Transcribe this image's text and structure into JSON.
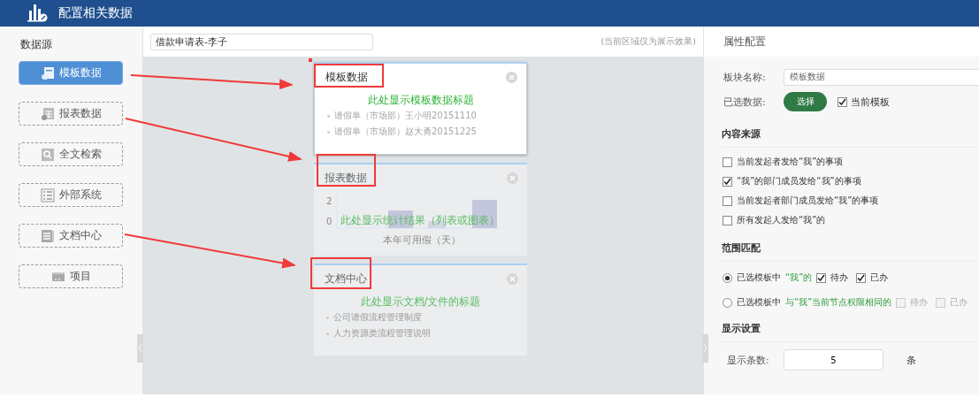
{
  "header": {
    "title": "配置相关数据"
  },
  "sidebar": {
    "title": "数据源",
    "items": [
      {
        "label": "模板数据",
        "selected": true
      },
      {
        "label": "报表数据",
        "selected": false
      },
      {
        "label": "全文检索",
        "selected": false
      },
      {
        "label": "外部系统",
        "selected": false
      },
      {
        "label": "文档中心",
        "selected": false
      },
      {
        "label": "项目",
        "selected": false
      }
    ]
  },
  "preview": {
    "form_field": {
      "value": "借款申请表-李子"
    },
    "note": "(当前区域仅为展示效果)",
    "cards": [
      {
        "kind": "list",
        "title": "模板数据",
        "selected": true,
        "hint": "此处显示模板数据标题",
        "items": [
          "请假单（市场部）王小明20151110",
          "请假单（市场部）赵大勇20151225"
        ]
      },
      {
        "kind": "chart",
        "title": "报表数据",
        "selected": false,
        "hint": "此处显示统计结果（列表或图表）",
        "y_ticks": [
          "2",
          "0"
        ],
        "caption": "本年可用假（天）"
      },
      {
        "kind": "list",
        "title": "文档中心",
        "selected": false,
        "hint": "此处显示文档/文件的标题",
        "items": [
          "公司请假流程管理制度",
          "人力资源类流程管理说明"
        ]
      }
    ]
  },
  "properties": {
    "title": "属性配置",
    "block_name": {
      "label": "板块名称:",
      "value": "模板数据"
    },
    "selected_data": {
      "label": "已选数据:",
      "button": "选择",
      "checkbox": {
        "label": "当前模板",
        "checked": true
      }
    },
    "content_source": {
      "title": "内容来源",
      "options": [
        {
          "label": "当前发起者发给“我”的事项",
          "checked": false
        },
        {
          "label": "“我”的部门成员发给“我”的事项",
          "checked": true
        },
        {
          "label": "当前发起者部门成员发给“我”的事项",
          "checked": false
        },
        {
          "label": "所有发起人发给“我”的",
          "checked": false
        }
      ]
    },
    "scope": {
      "title": "范围匹配",
      "options": [
        {
          "selected": true,
          "prefix": "已选模板中",
          "highlight": "“我”的",
          "checks": [
            {
              "label": "待办",
              "checked": true,
              "disabled": false
            },
            {
              "label": "已办",
              "checked": true,
              "disabled": false
            }
          ]
        },
        {
          "selected": false,
          "prefix": "已选模板中",
          "highlight": "与“我”当前节点权限相同的",
          "checks": [
            {
              "label": "待办",
              "checked": false,
              "disabled": true
            },
            {
              "label": "已办",
              "checked": false,
              "disabled": true
            }
          ]
        }
      ]
    },
    "display": {
      "title": "显示设置",
      "count_label": "显示条数:",
      "count_value": "5",
      "unit": "条"
    }
  }
}
